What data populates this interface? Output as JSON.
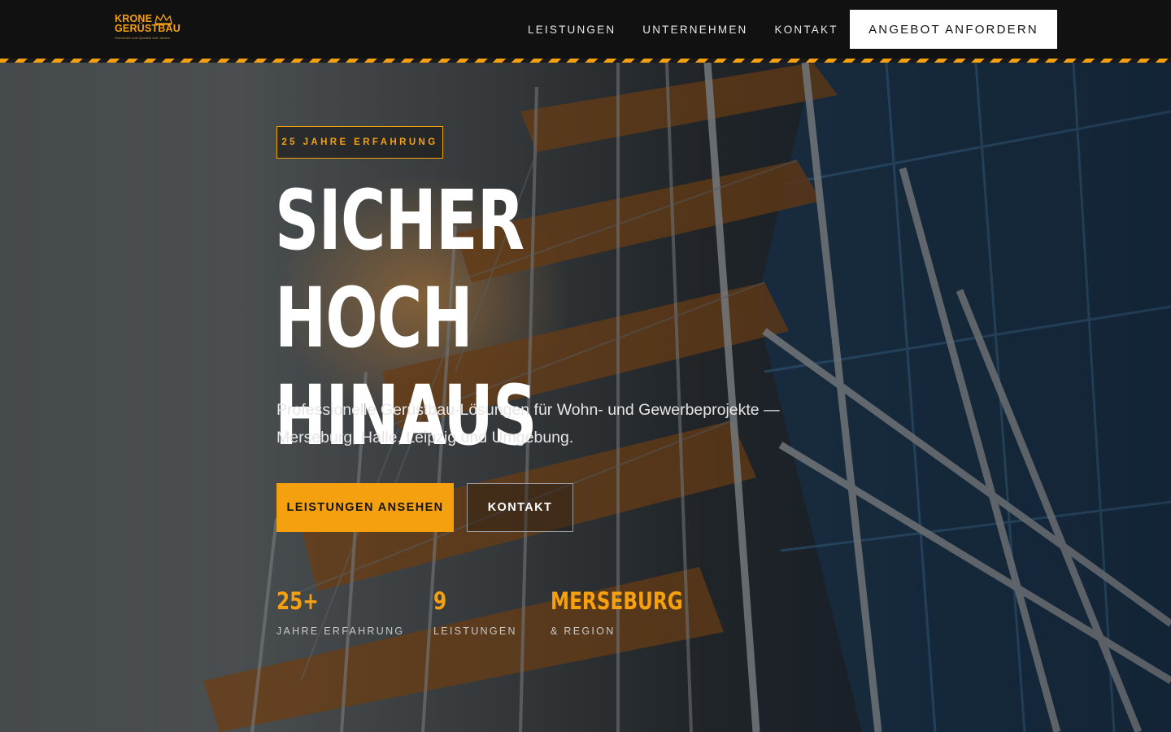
{
  "header": {
    "logo": {
      "line1": "KRONE",
      "line2": "GERÜSTBAU",
      "tagline": "Sicherheit und Qualität seit Jahren",
      "icon": "crown-icon"
    },
    "nav": [
      {
        "label": "LEISTUNGEN"
      },
      {
        "label": "UNTERNEHMEN"
      },
      {
        "label": "KONTAKT"
      }
    ],
    "cta_label": "ANGEBOT ANFORDERN"
  },
  "hero": {
    "badge": "25 JAHRE ERFAHRUNG",
    "headline_line1": "SICHER HOCH",
    "headline_line2": "HINAUS",
    "subtext": "Professionelle Gerüstbau-Lösungen für Wohn- und Gewerbeprojekte — Merseburg, Halle, Leipzig und Umgebung.",
    "primary_button": "LEISTUNGEN ANSEHEN",
    "secondary_button": "KONTAKT",
    "background_image": "scaffolding on building facade"
  },
  "stats": [
    {
      "value": "25+",
      "label": "JAHRE ERFAHRUNG"
    },
    {
      "value": "9",
      "label": "LEISTUNGEN"
    },
    {
      "value": "MERSEBURG",
      "label": "& REGION"
    }
  ],
  "colors": {
    "accent": "#f5a00f",
    "header_bg": "#111111",
    "cta_bg": "#ffffff"
  }
}
